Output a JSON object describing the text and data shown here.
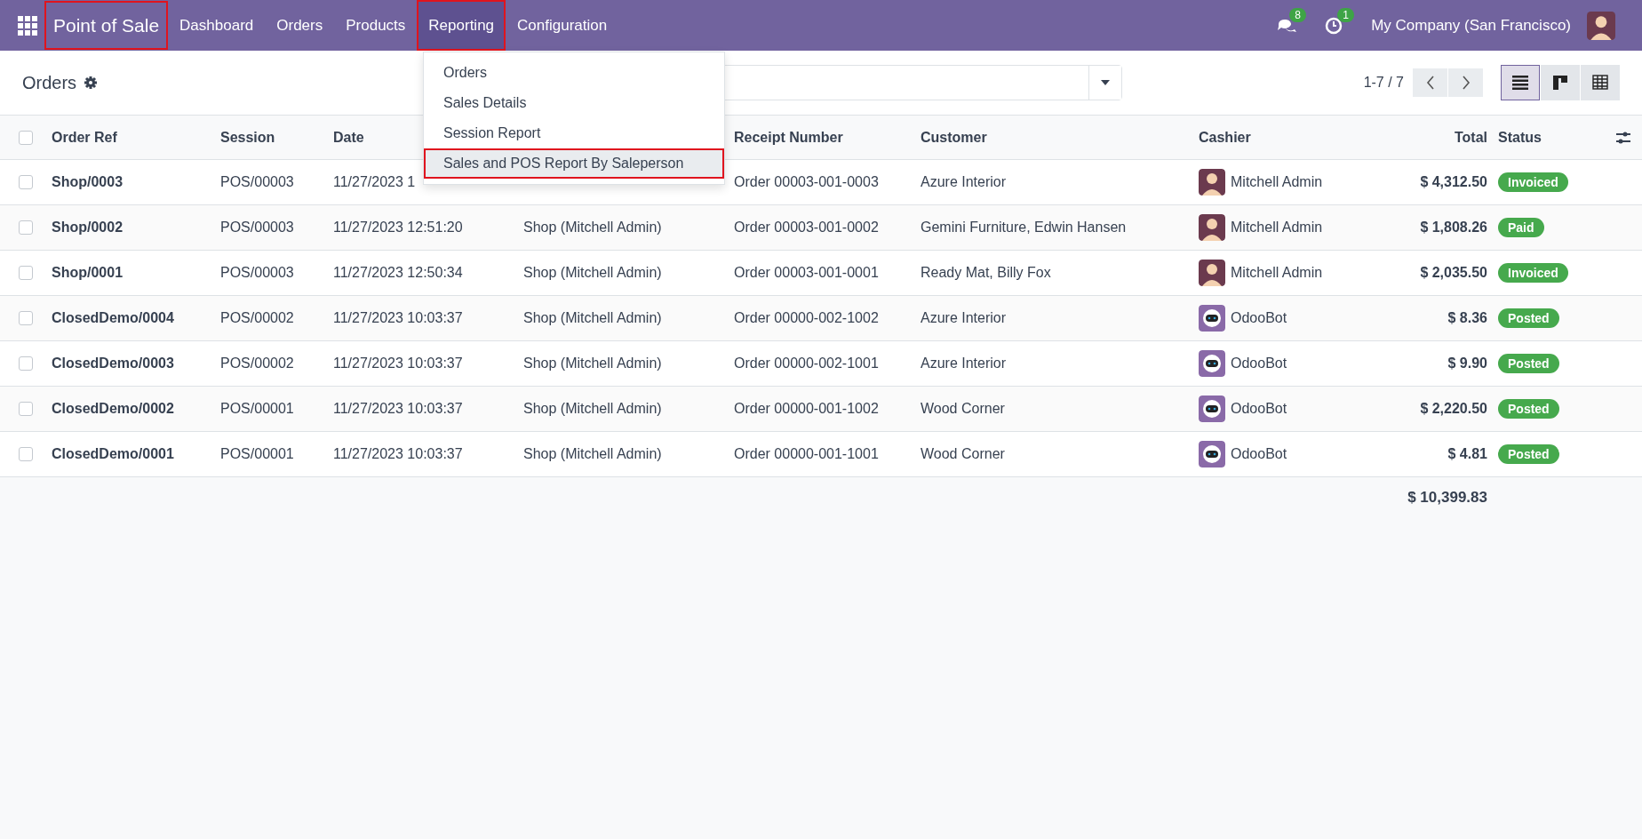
{
  "navbar": {
    "brand": {
      "label": "Point of Sale",
      "highlighted": true
    },
    "menu": [
      {
        "label": "Dashboard",
        "selected": false,
        "highlighted": false
      },
      {
        "label": "Orders",
        "selected": false,
        "highlighted": false
      },
      {
        "label": "Products",
        "selected": false,
        "highlighted": false
      },
      {
        "label": "Reporting",
        "selected": true,
        "highlighted": true
      },
      {
        "label": "Configuration",
        "selected": false,
        "highlighted": false
      }
    ],
    "messages_badge": "8",
    "activities_badge": "1",
    "company": "My Company (San Francisco)"
  },
  "reporting_menu": [
    {
      "label": "Orders",
      "selected": false,
      "highlighted": false
    },
    {
      "label": "Sales Details",
      "selected": false,
      "highlighted": false
    },
    {
      "label": "Session Report",
      "selected": false,
      "highlighted": false
    },
    {
      "label": "Sales and POS Report By Saleperson",
      "selected": true,
      "highlighted": true
    }
  ],
  "control_panel": {
    "title": "Orders",
    "pager": "1-7 / 7",
    "views": [
      {
        "kind": "list",
        "selected": true
      },
      {
        "kind": "kanban",
        "selected": false
      },
      {
        "kind": "pivot",
        "selected": false
      }
    ]
  },
  "table": {
    "select_all_checked": false,
    "columns": [
      "Order Ref",
      "Session",
      "Date",
      null,
      "Receipt Number",
      "Customer",
      "Cashier",
      "Total",
      "Status"
    ],
    "rows": [
      {
        "checked": false,
        "order_ref": "Shop/0003",
        "session": "POS/00003",
        "date": "11/27/2023 1",
        "receipt_number": "Order 00003-001-0003",
        "customer": "Azure Interior",
        "cashier": {
          "name": "Mitchell Admin",
          "kind": "person"
        },
        "total": "$ 4,312.50",
        "status": "Invoiced"
      },
      {
        "checked": false,
        "order_ref": "Shop/0002",
        "session": "POS/00003",
        "date": "11/27/2023 12:51:20",
        "point_of_sale": "Shop (Mitchell Admin)",
        "receipt_number": "Order 00003-001-0002",
        "customer": "Gemini Furniture, Edwin Hansen",
        "cashier": {
          "name": "Mitchell Admin",
          "kind": "person"
        },
        "total": "$ 1,808.26",
        "status": "Paid"
      },
      {
        "checked": false,
        "order_ref": "Shop/0001",
        "session": "POS/00003",
        "date": "11/27/2023 12:50:34",
        "point_of_sale": "Shop (Mitchell Admin)",
        "receipt_number": "Order 00003-001-0001",
        "customer": "Ready Mat, Billy Fox",
        "cashier": {
          "name": "Mitchell Admin",
          "kind": "person"
        },
        "total": "$ 2,035.50",
        "status": "Invoiced"
      },
      {
        "checked": false,
        "order_ref": "ClosedDemo/0004",
        "session": "POS/00002",
        "date": "11/27/2023 10:03:37",
        "point_of_sale": "Shop (Mitchell Admin)",
        "receipt_number": "Order 00000-002-1002",
        "customer": "Azure Interior",
        "cashier": {
          "name": "OdooBot",
          "kind": "bot"
        },
        "total": "$ 8.36",
        "status": "Posted"
      },
      {
        "checked": false,
        "order_ref": "ClosedDemo/0003",
        "session": "POS/00002",
        "date": "11/27/2023 10:03:37",
        "point_of_sale": "Shop (Mitchell Admin)",
        "receipt_number": "Order 00000-002-1001",
        "customer": "Azure Interior",
        "cashier": {
          "name": "OdooBot",
          "kind": "bot"
        },
        "total": "$ 9.90",
        "status": "Posted"
      },
      {
        "checked": false,
        "order_ref": "ClosedDemo/0002",
        "session": "POS/00001",
        "date": "11/27/2023 10:03:37",
        "point_of_sale": "Shop (Mitchell Admin)",
        "receipt_number": "Order 00000-001-1002",
        "customer": "Wood Corner",
        "cashier": {
          "name": "OdooBot",
          "kind": "bot"
        },
        "total": "$ 2,220.50",
        "status": "Posted"
      },
      {
        "checked": false,
        "order_ref": "ClosedDemo/0001",
        "session": "POS/00001",
        "date": "11/27/2023 10:03:37",
        "point_of_sale": "Shop (Mitchell Admin)",
        "receipt_number": "Order 00000-001-1001",
        "customer": "Wood Corner",
        "cashier": {
          "name": "OdooBot",
          "kind": "bot"
        },
        "total": "$ 4.81",
        "status": "Posted"
      }
    ],
    "sum_total": "$ 10,399.83"
  }
}
